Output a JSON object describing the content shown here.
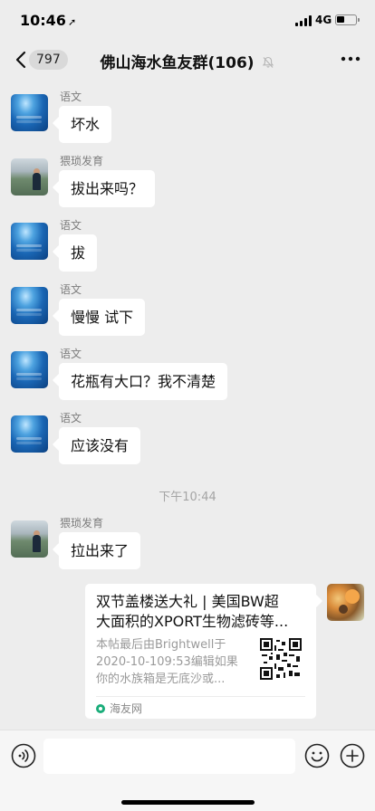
{
  "status_bar": {
    "time": "10:46",
    "network": "4G"
  },
  "nav": {
    "unread_count": "797",
    "title": "佛山海水鱼友群(106)"
  },
  "messages": [
    {
      "sender": "语文",
      "text": "坏水",
      "avatar": "ocean-avatar"
    },
    {
      "sender": "猥琐发育",
      "text": "拔出来吗？",
      "avatar": "person-avatar"
    },
    {
      "sender": "语文",
      "text": "拔",
      "avatar": "ocean-avatar"
    },
    {
      "sender": "语文",
      "text": "慢慢 试下",
      "avatar": "ocean-avatar"
    },
    {
      "sender": "语文",
      "text": "花瓶有大口？我不清楚",
      "avatar": "ocean-avatar"
    },
    {
      "sender": "语文",
      "text": "应该没有",
      "avatar": "ocean-avatar"
    }
  ],
  "time_divider": "下午10:44",
  "messages_after": [
    {
      "sender": "猥琐发育",
      "text": "拉出来了",
      "avatar": "person-avatar"
    }
  ],
  "link_card": {
    "title": "双节盖楼送大礼 | 美国BW超\n大面积的XPORT生物滤砖等...",
    "description": "本帖最后由Brightwell于\n2020-10-109:53编辑如果\n你的水族箱是无底沙或...",
    "source": "海友网"
  },
  "input": {
    "placeholder": ""
  },
  "colors": {
    "background": "#ededed",
    "bubble": "#ffffff",
    "source_icon": "#1aad7a"
  }
}
